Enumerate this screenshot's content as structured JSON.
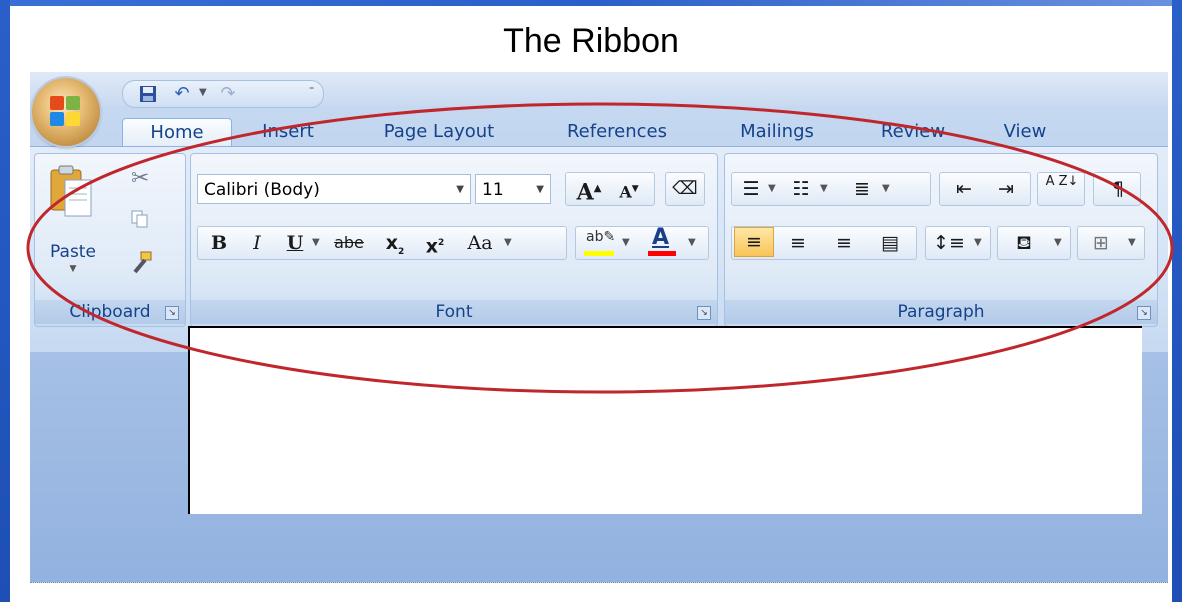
{
  "slide": {
    "title": "The Ribbon"
  },
  "qat": {
    "save_icon": "save-icon",
    "undo_icon": "undo-icon",
    "redo_icon": "redo-icon"
  },
  "tabs": [
    {
      "label": "Home",
      "active": true
    },
    {
      "label": "Insert",
      "active": false
    },
    {
      "label": "Page Layout",
      "active": false
    },
    {
      "label": "References",
      "active": false
    },
    {
      "label": "Mailings",
      "active": false
    },
    {
      "label": "Review",
      "active": false
    },
    {
      "label": "View",
      "active": false
    }
  ],
  "clipboard": {
    "paste_label": "Paste",
    "group_label": "Clipboard"
  },
  "font": {
    "font_name": "Calibri (Body)",
    "font_size": "11",
    "bold": "B",
    "italic": "I",
    "underline": "U",
    "strike": "abe",
    "subscript": "x",
    "superscript": "x",
    "change_case": "Aa",
    "grow": "A",
    "shrink": "A",
    "group_label": "Font"
  },
  "paragraph": {
    "sort": "A Z",
    "pilcrow": "¶",
    "group_label": "Paragraph"
  },
  "colors": {
    "ribbon_text": "#15428b",
    "annotation": "#c0272d",
    "highlight": "#ffff00",
    "font_color": "#ff0000",
    "slide_edge": "#2a5fc9"
  }
}
